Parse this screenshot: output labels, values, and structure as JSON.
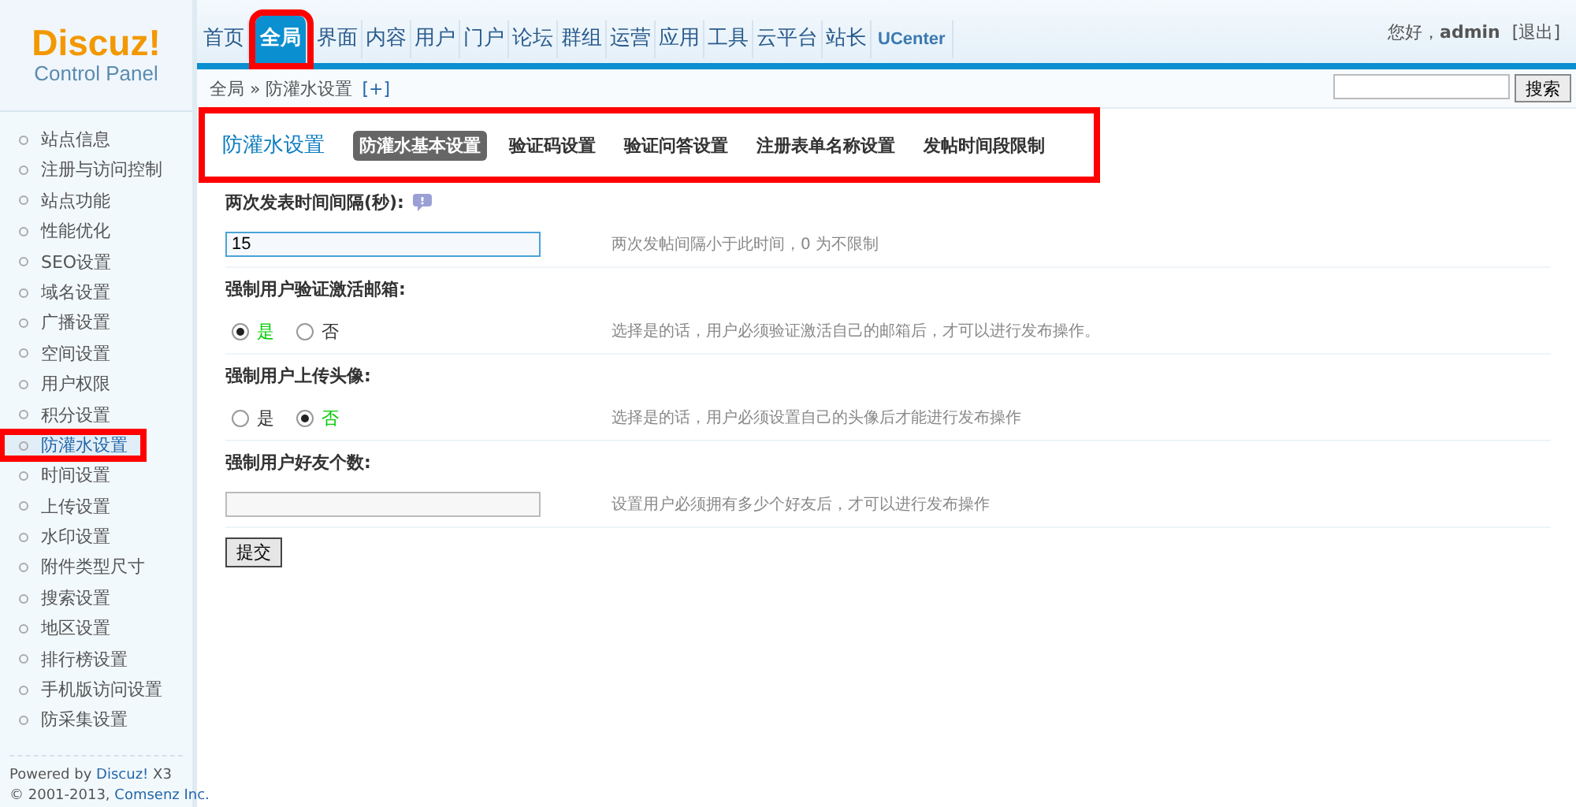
{
  "logo": {
    "name": "Discuz!",
    "subtitle": "Control Panel"
  },
  "nav": [
    {
      "label": "首页",
      "selected": false,
      "highlighted": false
    },
    {
      "label": "全局",
      "selected": true,
      "highlighted": true
    },
    {
      "label": "界面",
      "selected": false,
      "highlighted": false
    },
    {
      "label": "内容",
      "selected": false,
      "highlighted": false
    },
    {
      "label": "用户",
      "selected": false,
      "highlighted": false
    },
    {
      "label": "门户",
      "selected": false,
      "highlighted": false
    },
    {
      "label": "论坛",
      "selected": false,
      "highlighted": false
    },
    {
      "label": "群组",
      "selected": false,
      "highlighted": false
    },
    {
      "label": "运营",
      "selected": false,
      "highlighted": false
    },
    {
      "label": "应用",
      "selected": false,
      "highlighted": false
    },
    {
      "label": "工具",
      "selected": false,
      "highlighted": false
    },
    {
      "label": "云平台",
      "selected": false,
      "highlighted": false
    },
    {
      "label": "站长",
      "selected": false,
      "highlighted": false
    },
    {
      "label": "UCenter",
      "selected": false,
      "highlighted": false
    }
  ],
  "user": {
    "greeting": "您好，**admin**",
    "logout": "[退出]"
  },
  "breadcrumb": {
    "path": "全局 » 防灌水设置",
    "add": "[+]"
  },
  "search": {
    "button": "搜索"
  },
  "sidebar": {
    "items": [
      {
        "label": "站点信息",
        "selected": false,
        "highlighted": false
      },
      {
        "label": "注册与访问控制",
        "selected": false,
        "highlighted": false
      },
      {
        "label": "站点功能",
        "selected": false,
        "highlighted": false
      },
      {
        "label": "性能优化",
        "selected": false,
        "highlighted": false
      },
      {
        "label": "SEO设置",
        "selected": false,
        "highlighted": false
      },
      {
        "label": "域名设置",
        "selected": false,
        "highlighted": false
      },
      {
        "label": "广播设置",
        "selected": false,
        "highlighted": false
      },
      {
        "label": "空间设置",
        "selected": false,
        "highlighted": false
      },
      {
        "label": "用户权限",
        "selected": false,
        "highlighted": false
      },
      {
        "label": "积分设置",
        "selected": false,
        "highlighted": false
      },
      {
        "label": "防灌水设置",
        "selected": true,
        "highlighted": true
      },
      {
        "label": "时间设置",
        "selected": false,
        "highlighted": false
      },
      {
        "label": "上传设置",
        "selected": false,
        "highlighted": false
      },
      {
        "label": "水印设置",
        "selected": false,
        "highlighted": false
      },
      {
        "label": "附件类型尺寸",
        "selected": false,
        "highlighted": false
      },
      {
        "label": "搜索设置",
        "selected": false,
        "highlighted": false
      },
      {
        "label": "地区设置",
        "selected": false,
        "highlighted": false
      },
      {
        "label": "排行榜设置",
        "selected": false,
        "highlighted": false
      },
      {
        "label": "手机版访问设置",
        "selected": false,
        "highlighted": false
      },
      {
        "label": "防采集设置",
        "selected": false,
        "highlighted": false
      }
    ],
    "footer": {
      "powered": "Powered by",
      "link": "Discuz!",
      "version": "X3",
      "copyright": "© 2001-2013,",
      "company": "Comsenz Inc."
    }
  },
  "panel": {
    "title": "防灌水设置",
    "highlighted": true,
    "tabs": [
      {
        "label": "防灌水基本设置",
        "selected": true
      },
      {
        "label": "验证码设置",
        "selected": false
      },
      {
        "label": "验证问答设置",
        "selected": false
      },
      {
        "label": "注册表单名称设置",
        "selected": false
      },
      {
        "label": "发帖时间段限制",
        "selected": false
      }
    ]
  },
  "settings": [
    {
      "kind": "text",
      "label": "两次发表时间间隔(秒):",
      "help": true,
      "value": "15",
      "focused": true,
      "hint": "两次发帖间隔小于此时间，0 为不限制"
    },
    {
      "kind": "radio",
      "label": "强制用户验证激活邮箱:",
      "options": [
        {
          "label": "是",
          "selected": true
        },
        {
          "label": "否",
          "selected": false
        }
      ],
      "hint": "选择是的话，用户必须验证激活自己的邮箱后，才可以进行发布操作。"
    },
    {
      "kind": "radio",
      "label": "强制用户上传头像:",
      "options": [
        {
          "label": "是",
          "selected": false
        },
        {
          "label": "否",
          "selected": true
        }
      ],
      "hint": "选择是的话，用户必须设置自己的头像后才能进行发布操作"
    },
    {
      "kind": "text",
      "label": "强制用户好友个数:",
      "focused": false,
      "hint": "设置用户必须拥有多少个好友后，才可以进行发布操作"
    }
  ],
  "submit": "提交"
}
